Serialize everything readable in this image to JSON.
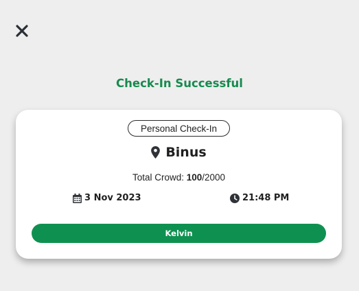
{
  "header": {
    "close_icon": "close-icon",
    "title": "Check-In Successful",
    "title_color": "#178a4f"
  },
  "checkin": {
    "type_label": "Personal Check-In",
    "location_icon": "map-pin-icon",
    "location_name": "Binus",
    "crowd_label": "Total Crowd: ",
    "crowd_current": "100",
    "crowd_max": "/2000",
    "date_icon": "calendar-icon",
    "date": "3 Nov 2023",
    "time_icon": "clock-icon",
    "time": "21:48 PM",
    "user_button_label": "Kelvin",
    "accent_color": "#0e9150"
  }
}
